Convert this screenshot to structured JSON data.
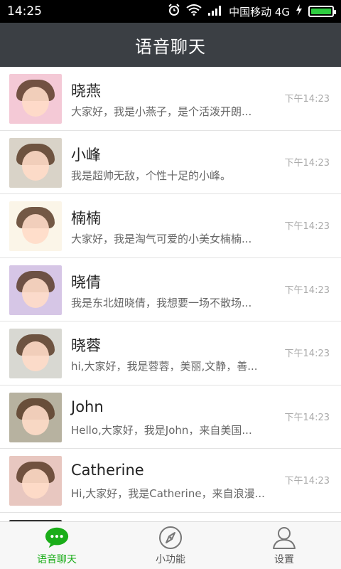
{
  "status_bar": {
    "time": "14:25",
    "carrier": "中国移动 4G",
    "battery_level": 1.0
  },
  "header": {
    "title": "语音聊天"
  },
  "chats": [
    {
      "name": "晓燕",
      "message": "大家好，我是小燕子，是个活泼开朗...",
      "time": "下午14:23",
      "avatar_bg": "#f4c9d6"
    },
    {
      "name": "小峰",
      "message": "我是超帅无敌，个性十足的小峰。",
      "time": "下午14:23",
      "avatar_bg": "#d9d3c8"
    },
    {
      "name": "楠楠",
      "message": "大家好，我是淘气可爱的小美女楠楠...",
      "time": "下午14:23",
      "avatar_bg": "#fbf5e8"
    },
    {
      "name": "晓倩",
      "message": "我是东北妞晓倩，我想要一场不散场...",
      "time": "下午14:23",
      "avatar_bg": "#d6c6e6"
    },
    {
      "name": "晓蓉",
      "message": "hi,大家好，我是蓉蓉，美丽,文静，善...",
      "time": "下午14:23",
      "avatar_bg": "#d8d8d2"
    },
    {
      "name": "John",
      "message": "Hello,大家好，我是John，来自美国...",
      "time": "下午14:23",
      "avatar_bg": "#b7b2a0"
    },
    {
      "name": "Catherine",
      "message": "Hi,大家好，我是Catherine，来自浪漫...",
      "time": "下午14:23",
      "avatar_bg": "#e8c7c0"
    }
  ],
  "tabs": [
    {
      "label": "语音聊天",
      "icon": "chat-bubble-icon",
      "active": true
    },
    {
      "label": "小功能",
      "icon": "compass-icon",
      "active": false
    },
    {
      "label": "设置",
      "icon": "person-icon",
      "active": false
    }
  ],
  "colors": {
    "accent": "#1aad19",
    "header_bg": "#3b3f44"
  }
}
